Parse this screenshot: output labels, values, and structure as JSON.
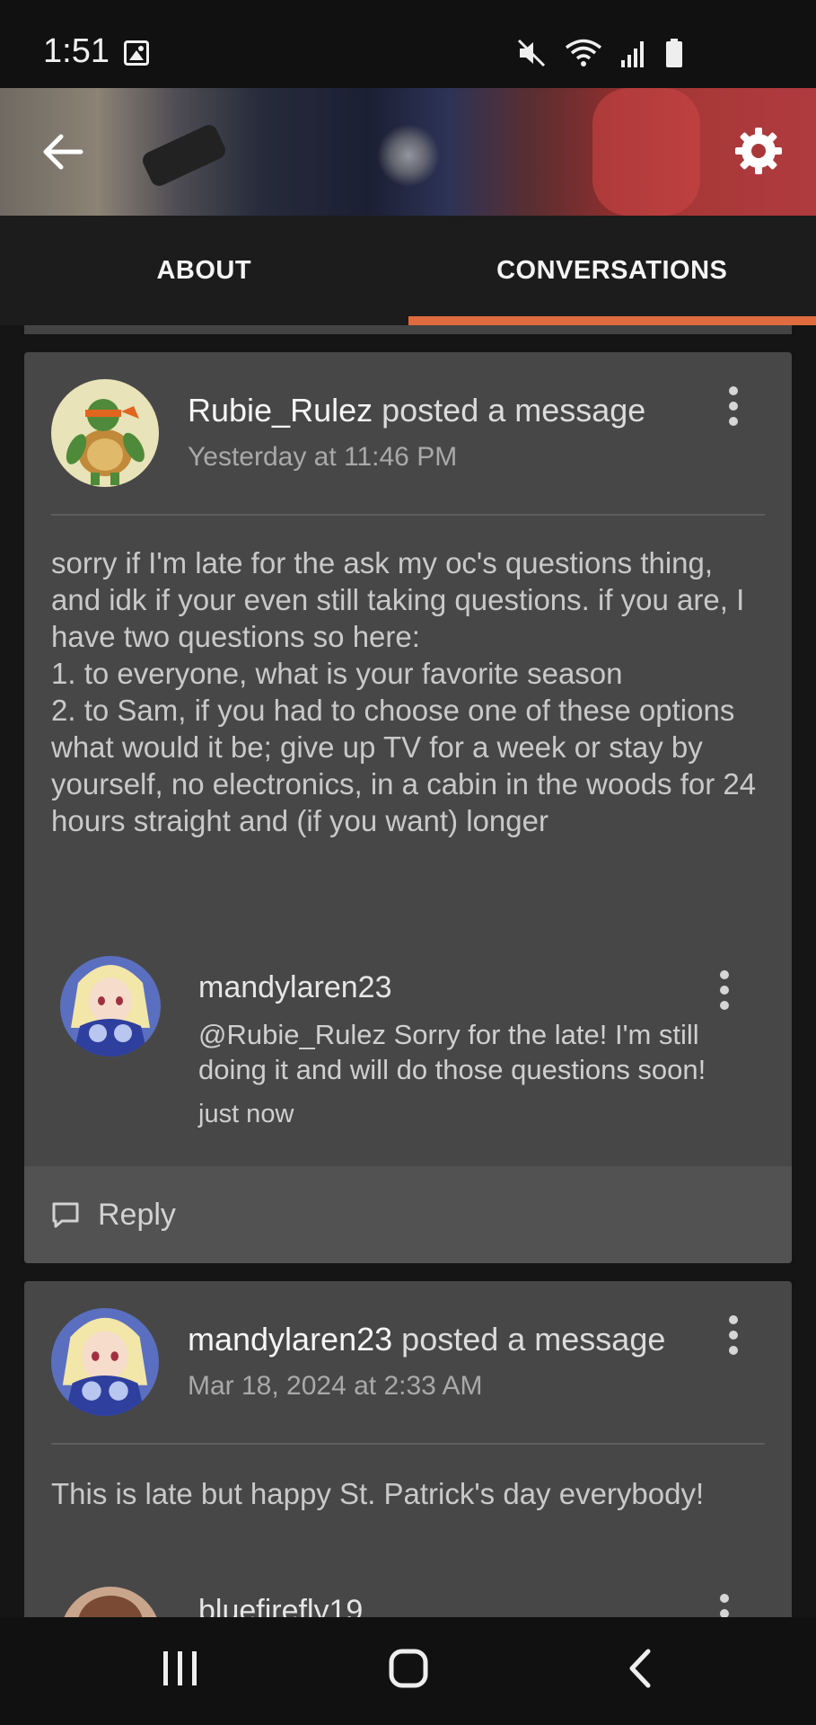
{
  "status_bar": {
    "time": "1:51",
    "icons": [
      "image-icon",
      "mute-icon",
      "wifi-icon",
      "signal-icon",
      "battery-icon"
    ]
  },
  "header": {
    "back_icon": "arrow-left-icon",
    "settings_icon": "gear-icon"
  },
  "tabs": [
    {
      "label": "ABOUT",
      "active": false
    },
    {
      "label": "CONVERSATIONS",
      "active": true
    }
  ],
  "accent_color": "#e06b3e",
  "posts": [
    {
      "author": "Rubie_Rulez",
      "action": "posted a message",
      "time": "Yesterday at 11:46 PM",
      "body": "sorry if I'm late for the ask my oc's questions thing, and idk if your even still taking questions. if you are, I have two questions so here:\n1. to everyone, what is your favorite season\n2. to Sam, if you had to choose one of these options what would it be; give up TV for a week or stay by yourself, no electronics, in a cabin in the woods for 24 hours straight and (if you want) longer",
      "reply": {
        "author": "mandylaren23",
        "text": "@Rubie_Rulez Sorry for the late! I'm still doing it and will do those questions soon!",
        "time": "just now"
      },
      "reply_label": "Reply"
    },
    {
      "author": "mandylaren23",
      "action": "posted a message",
      "time": "Mar 18, 2024 at 2:33 AM",
      "body": "This is late but happy St. Patrick's day everybody!",
      "reply": {
        "author": "bluefirefly19"
      }
    }
  ]
}
